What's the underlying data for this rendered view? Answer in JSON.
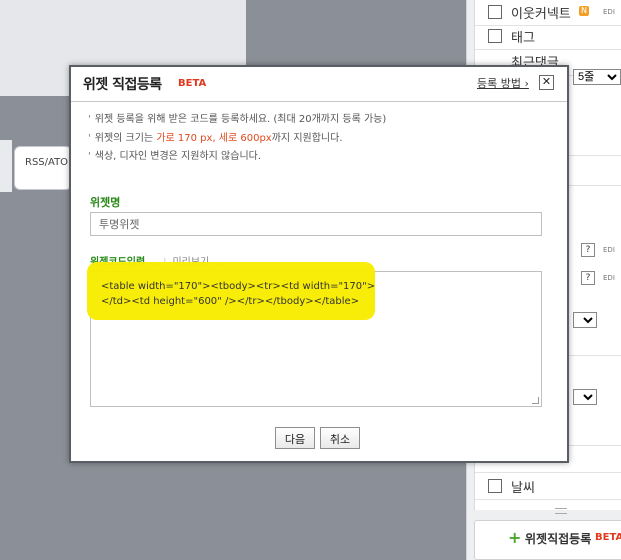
{
  "background": {
    "rss_label": "RSS/ATOM"
  },
  "right_panel": {
    "items": [
      {
        "label": "이웃커넥트",
        "badge": "N",
        "edit": "EDI"
      },
      {
        "label": "태그"
      },
      {
        "label": "최근댓글"
      }
    ],
    "select_value": "5줄",
    "weather_label": "날씨",
    "edit_label": "EDI",
    "add_widget_label": "위젯직접등록",
    "add_widget_beta": "BETA"
  },
  "dialog": {
    "title": "위젯 직접등록",
    "beta": "BETA",
    "help_label": "등록 방법",
    "close_icon": "close-icon",
    "notes": {
      "line1": "위젯 등록을 위해 받은 코드를 등록하세요. (최대 20개까지 등록 가능)",
      "line2_before": "위젯의 크기는",
      "line2_highlight": "가로 170 px, 세로 600px",
      "line2_after": "까지 지원합니다.",
      "line3": "색상, 디자인 변경은 지원하지 않습니다."
    },
    "name_label": "위젯명",
    "name_value": "투명위젯",
    "tab_code": "위젯코드입력",
    "tab_preview": "미리보기",
    "code_value": "<table width=\"170\"><tbody><tr><td width=\"170\">\n</td><td height=\"600\" /></tr></tbody></table>",
    "next_button": "다음",
    "cancel_button": "취소"
  },
  "colors": {
    "accent_green": "#2a8a17",
    "beta_red": "#e03a1e",
    "highlight_yellow": "#f8ec00"
  }
}
